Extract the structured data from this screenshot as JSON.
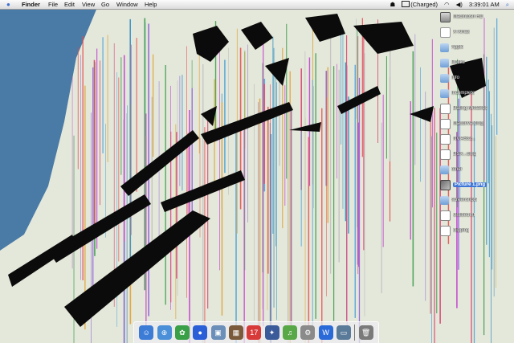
{
  "menubar": {
    "apple_icon": "apple-icon",
    "items": [
      {
        "label": "Finder",
        "bold": true
      },
      {
        "label": "File"
      },
      {
        "label": "Edit"
      },
      {
        "label": "View"
      },
      {
        "label": "Go"
      },
      {
        "label": "Window"
      },
      {
        "label": "Help"
      }
    ],
    "status": {
      "user_icon": "user-icon",
      "battery": "(Charged)",
      "wifi_icon": "wifi-icon",
      "volume_icon": "volume-icon",
      "clock": "3:39:01 AM",
      "spotlight_icon": "search-icon"
    }
  },
  "desktop_icons": [
    {
      "label": "Macintosh HD",
      "kind": "hd"
    },
    {
      "label": "X-Xmax",
      "kind": "disk"
    },
    {
      "label": "Apple",
      "kind": "folder"
    },
    {
      "label": "Docks",
      "kind": "folder"
    },
    {
      "label": "Info",
      "kind": "folder"
    },
    {
      "label": "Incomplete",
      "kind": "folder"
    },
    {
      "label": "Dating Mistakes",
      "kind": "doc"
    },
    {
      "label": "Macdrive.dmg",
      "kind": "doc"
    },
    {
      "label": "NVI4532...",
      "kind": "doc"
    },
    {
      "label": "DSX...dmg",
      "kind": "doc"
    },
    {
      "label": "other",
      "kind": "folder"
    },
    {
      "label": "Picture 1.png",
      "kind": "img",
      "selected": true
    },
    {
      "label": "screenshots",
      "kind": "folder"
    },
    {
      "label": "Untitled.rtf",
      "kind": "doc"
    },
    {
      "label": "clipping",
      "kind": "doc"
    }
  ],
  "dock": {
    "items": [
      {
        "name": "finder",
        "color": "#3c7bd6",
        "glyph": "☺"
      },
      {
        "name": "safari",
        "color": "#4a8fd8",
        "glyph": "⊕"
      },
      {
        "name": "adium",
        "color": "#3aa048",
        "glyph": "✿"
      },
      {
        "name": "messenger",
        "color": "#2a5fd8",
        "glyph": "●"
      },
      {
        "name": "preview",
        "color": "#6b8fb8",
        "glyph": "▣"
      },
      {
        "name": "photo",
        "color": "#7a5a3a",
        "glyph": "▦"
      },
      {
        "name": "ical",
        "color": "#d83a3a",
        "glyph": "17"
      },
      {
        "name": "imovie",
        "color": "#3a5a9a",
        "glyph": "✦"
      },
      {
        "name": "itunes",
        "color": "#58a848",
        "glyph": "♫"
      },
      {
        "name": "system-prefs",
        "color": "#8a8a8a",
        "glyph": "⚙"
      },
      {
        "name": "word",
        "color": "#2a6ad8",
        "glyph": "W"
      },
      {
        "name": "monitor",
        "color": "#5a7a9a",
        "glyph": "▭"
      },
      {
        "name": "trash",
        "color": "#7a7a7a",
        "glyph": "🗑"
      }
    ]
  }
}
